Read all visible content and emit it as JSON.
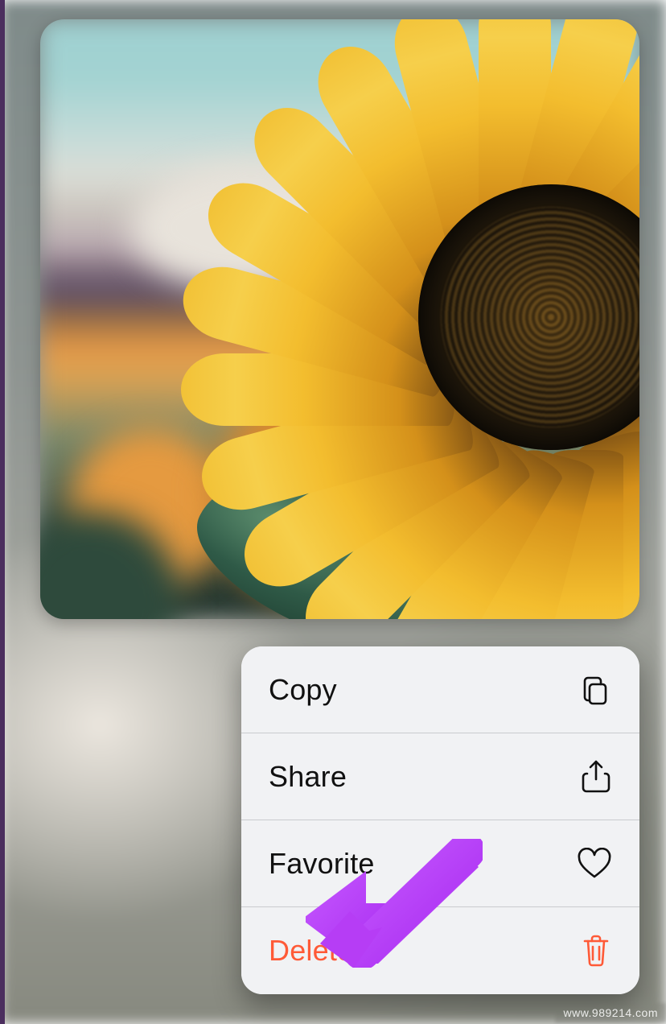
{
  "photo": {
    "description": "sunflower-photo"
  },
  "context_menu": {
    "items": [
      {
        "label": "Copy",
        "icon": "copy-icon",
        "destructive": false
      },
      {
        "label": "Share",
        "icon": "share-icon",
        "destructive": false
      },
      {
        "label": "Favorite",
        "icon": "heart-icon",
        "destructive": false
      },
      {
        "label": "Delete",
        "icon": "trash-icon",
        "destructive": true
      }
    ]
  },
  "annotation": {
    "arrow_color": "#b63df5",
    "points_to": "delete"
  },
  "watermark": "www.989214.com"
}
